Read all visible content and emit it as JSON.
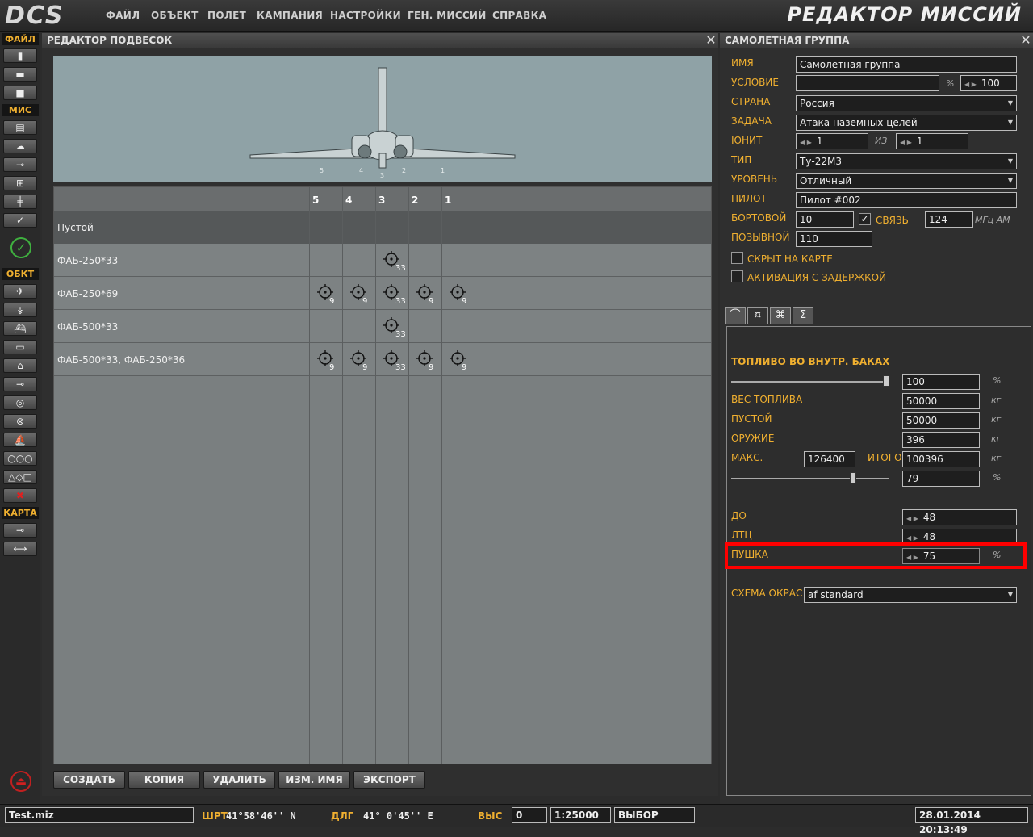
{
  "app": {
    "logo": "DCS",
    "title": "РЕДАКТОР МИССИЙ",
    "menu": [
      "ФАЙЛ",
      "ОБЪЕКТ",
      "ПОЛЕТ",
      "КАМПАНИЯ",
      "НАСТРОЙКИ",
      "ГЕН. МИССИЙ",
      "СПРАВКА"
    ]
  },
  "toolbar": {
    "file_label": "ФАЙЛ",
    "mis_label": "МИС",
    "obj_label": "ОБКТ",
    "map_label": "КАРТА",
    "check_glyph": "✓",
    "ok_glyph": "✓",
    "delete_glyph": "✖",
    "shapes_glyph": "△◇□",
    "eject_glyph": "⏏"
  },
  "payload_editor": {
    "title": "РЕДАКТОР ПОДВЕСОК",
    "close": "✕",
    "preview_pylons": [
      "5",
      "4",
      "3",
      "2",
      "1"
    ],
    "columns": [
      "5",
      "4",
      "3",
      "2",
      "1"
    ],
    "rows": [
      {
        "name": "Пустой",
        "pylons": {}
      },
      {
        "name": "ФАБ-250*33",
        "pylons": {
          "3": "33"
        }
      },
      {
        "name": "ФАБ-250*69",
        "pylons": {
          "5": "9",
          "4": "9",
          "3": "33",
          "2": "9",
          "1": "9"
        }
      },
      {
        "name": "ФАБ-500*33",
        "pylons": {
          "3": "33"
        }
      },
      {
        "name": "ФАБ-500*33, ФАБ-250*36",
        "pylons": {
          "5": "9",
          "4": "9",
          "3": "33",
          "2": "9",
          "1": "9"
        }
      }
    ],
    "buttons": {
      "create": "СОЗДАТЬ",
      "copy": "КОПИЯ",
      "delete": "УДАЛИТЬ",
      "rename": "ИЗМ. ИМЯ",
      "export": "ЭКСПОРТ"
    }
  },
  "group": {
    "title": "САМОЛЕТНАЯ ГРУППА",
    "close": "✕",
    "name_label": "ИМЯ",
    "name_value": "Самолетная группа",
    "condition_label": "УСЛОВИЕ",
    "condition_value": "",
    "condition_pct_unit": "%",
    "condition_pct": "100",
    "country_label": "СТРАНА",
    "country_value": "Россия",
    "task_label": "ЗАДАЧА",
    "task_value": "Атака наземных целей",
    "unit_label": "ЮНИТ",
    "unit_value": "1",
    "of_label": "ИЗ",
    "of_value": "1",
    "type_label": "ТИП",
    "type_value": "Ту-22М3",
    "skill_label": "УРОВЕНЬ",
    "skill_value": "Отличный",
    "pilot_label": "ПИЛОТ",
    "pilot_value": "Пилот #002",
    "board_label": "БОРТОВОЙ",
    "board_value": "10",
    "comm_label": "СВЯЗЬ",
    "comm_checked": "✓",
    "freq_value": "124",
    "freq_unit": "МГц АМ",
    "callsign_label": "ПОЗЫВНОЙ",
    "callsign_value": "110",
    "hidden_label": "СКРЫТ НА КАРТЕ",
    "late_label": "АКТИВАЦИЯ С ЗАДЕРЖКОЙ"
  },
  "tabs": [
    "⌒",
    "¤",
    "⌘",
    "Σ"
  ],
  "fuel": {
    "header": "ТОПЛИВО ВО ВНУТР. БАКАХ",
    "fuel_pct": "100",
    "pct_unit": "%",
    "kg_unit": "кг",
    "fuel_weight_label": "ВЕС ТОПЛИВА",
    "fuel_weight": "50000",
    "empty_label": "ПУСТОЙ",
    "empty_weight": "50000",
    "weapons_label": "ОРУЖИЕ",
    "weapons_weight": "396",
    "max_label": "МАКС.",
    "max_weight": "126400",
    "total_label": "ИТОГО",
    "total_weight": "100396",
    "total_pct": "79",
    "chaff_label": "ДО",
    "chaff_value": "48",
    "flare_label": "ЛТЦ",
    "flare_value": "48",
    "gun_label": "ПУШКА",
    "gun_value": "75",
    "livery_label": "СХЕМА ОКРАС",
    "livery_value": "af standard"
  },
  "status": {
    "file": "Test.miz",
    "lat_label": "ШРТ",
    "lat_value": "41°58'46'' N",
    "lon_label": "ДЛГ",
    "lon_value": "41° 0'45'' E",
    "alt_label": "ВЫС",
    "alt_value": "0",
    "scale": "1:25000",
    "mode": "ВЫБОР",
    "datetime": "28.01.2014 20:13:49"
  },
  "colors": {
    "accent": "#f0b030",
    "highlight": "#ff0000"
  }
}
